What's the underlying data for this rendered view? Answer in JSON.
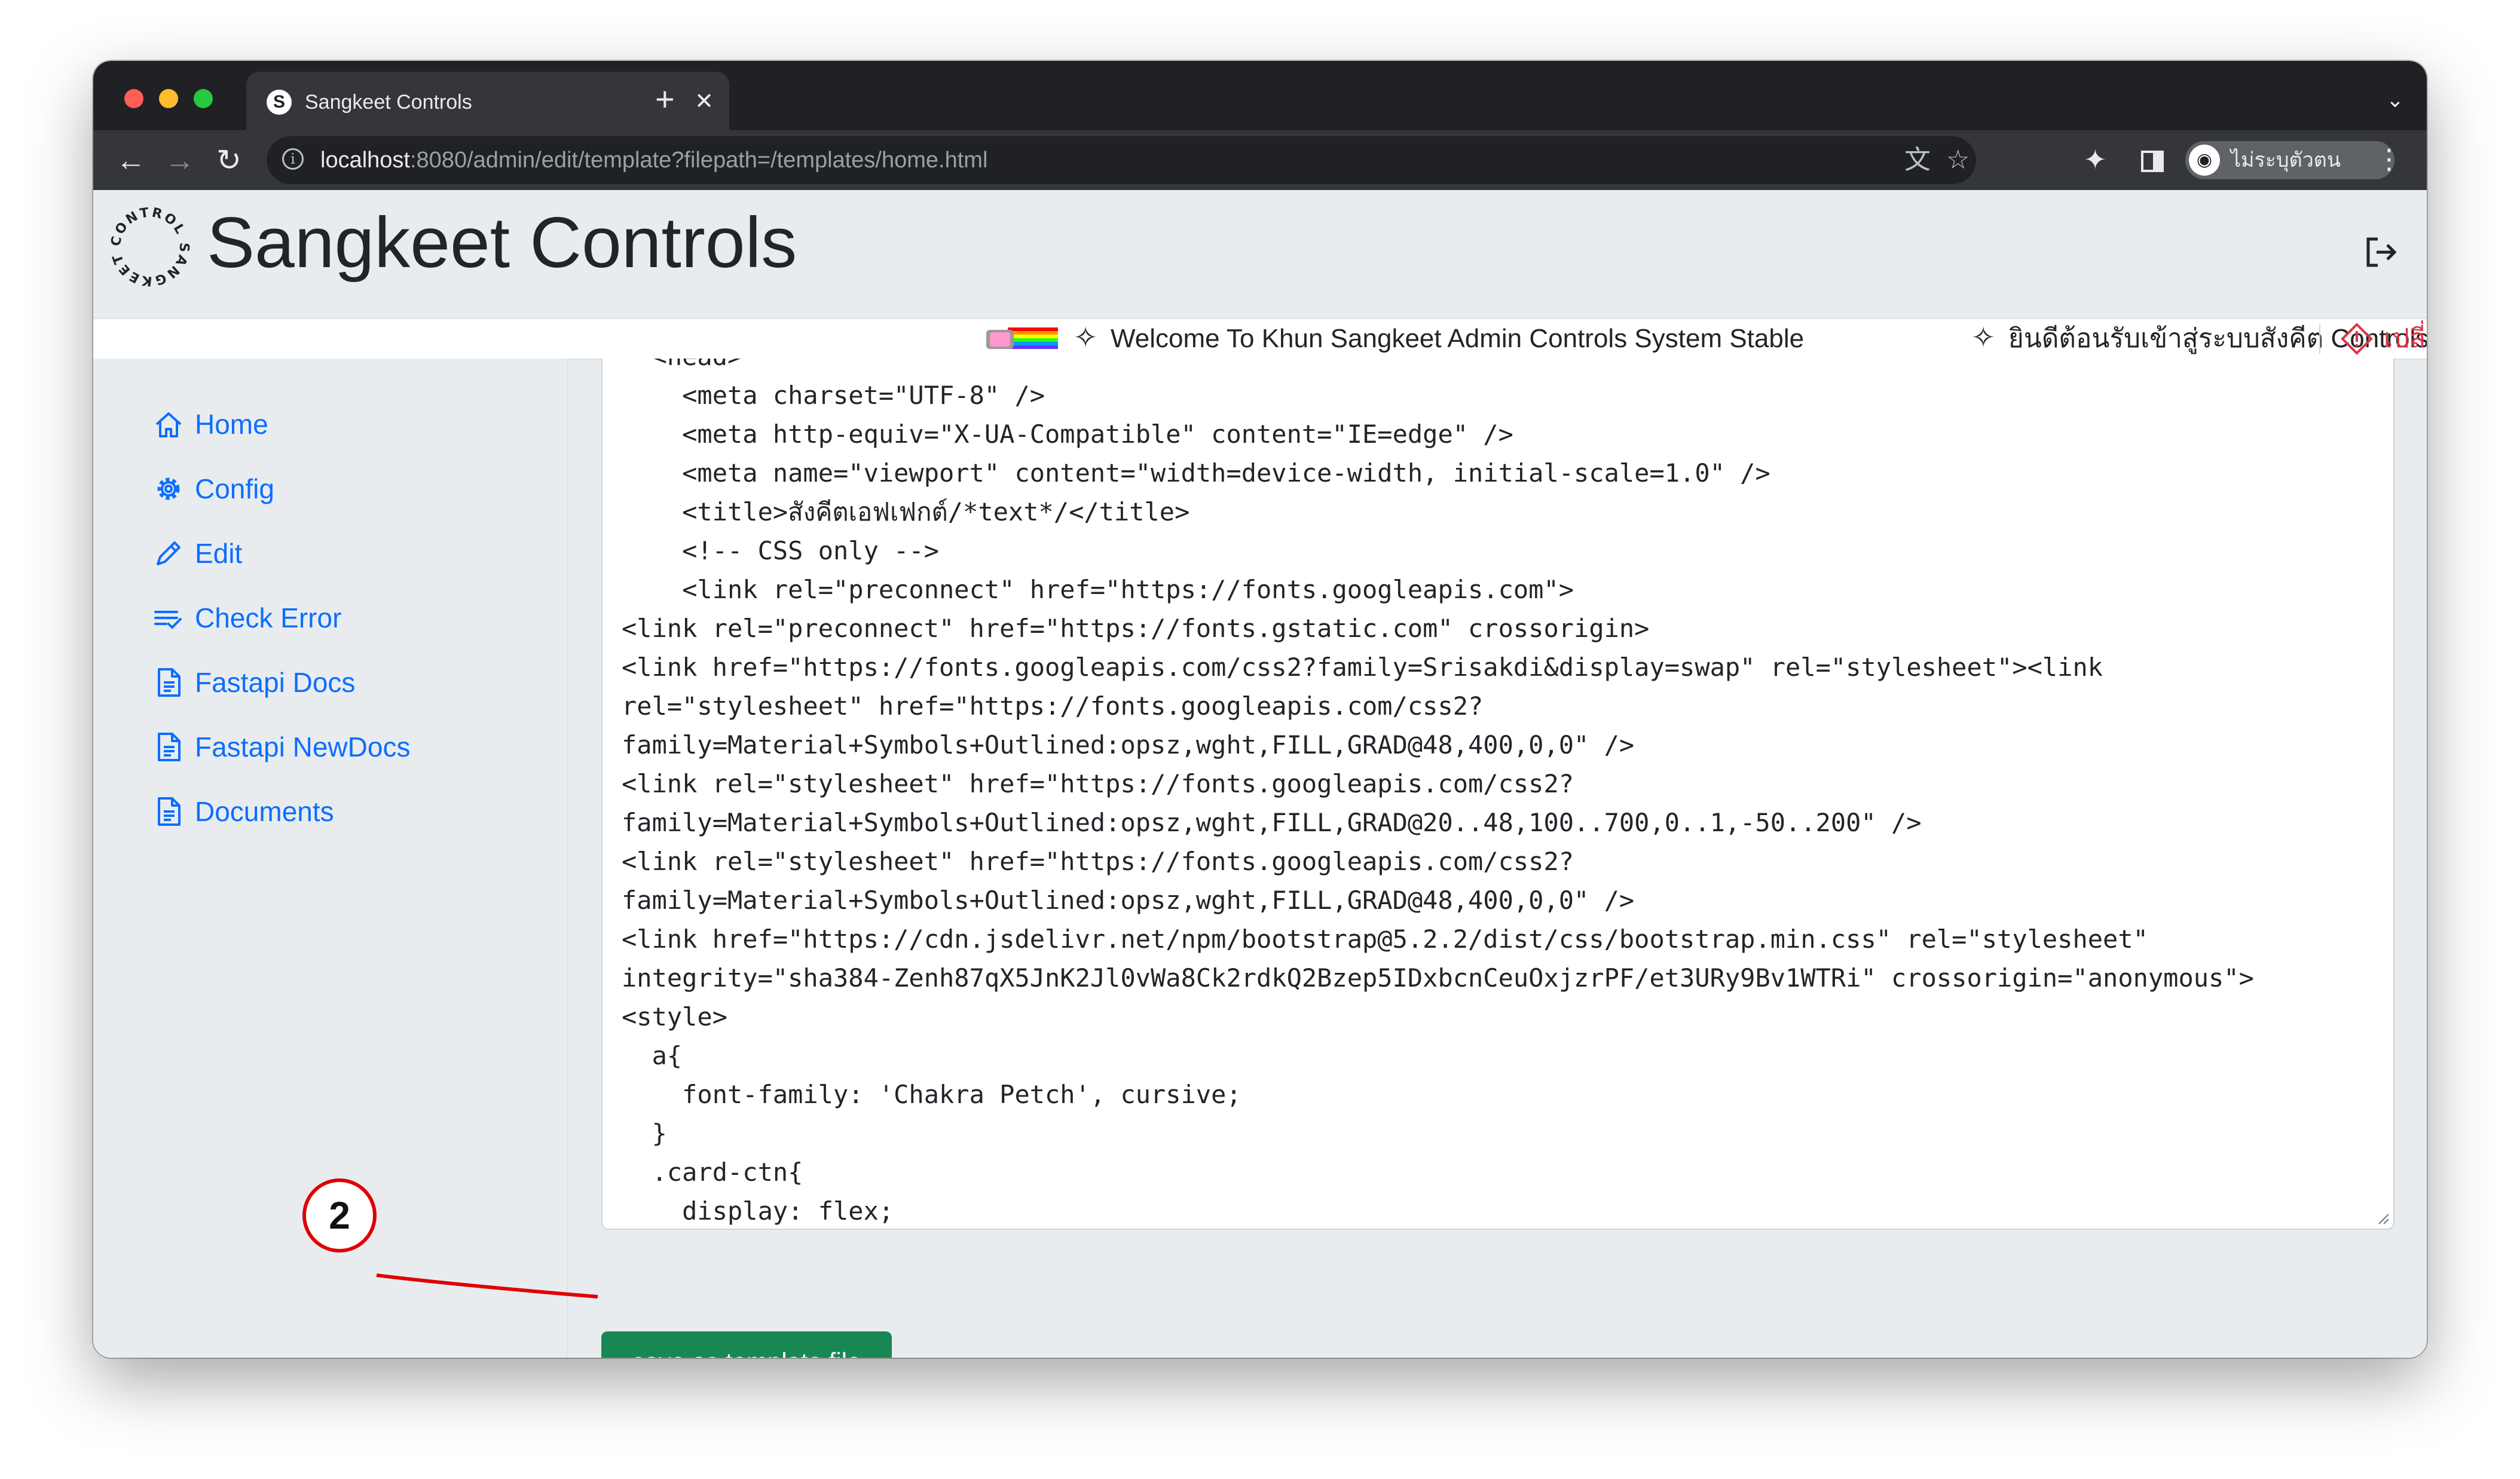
{
  "browser": {
    "tab_title": "Sangkeet Controls",
    "tab_close": "✕",
    "new_tab": "+",
    "url_host": "localhost",
    "url_rest": ":8080/admin/edit/template?filepath=/templates/home.html",
    "profile_label": "ไม่ระบุตัวตน"
  },
  "site": {
    "title": "Sangkeet Controls",
    "logo_text": "CONTROL SANGKEET"
  },
  "marquee": {
    "welcome_en": "Welcome To Khun Sangkeet Admin Controls System Stable",
    "welcome_th": "ยินดีต้อนรับเข้าสู่ระบบสังคีต Controls",
    "alert_prefix": "เปลี่"
  },
  "sidebar": {
    "items": [
      {
        "label": "Home",
        "icon": "house-icon"
      },
      {
        "label": "Config",
        "icon": "gear-icon"
      },
      {
        "label": "Edit",
        "icon": "pencil-icon"
      },
      {
        "label": "Check Error",
        "icon": "list-check-icon"
      },
      {
        "label": "Fastapi Docs",
        "icon": "document-icon"
      },
      {
        "label": "Fastapi NewDocs",
        "icon": "document-icon"
      },
      {
        "label": "Documents",
        "icon": "document-icon"
      }
    ]
  },
  "editor": {
    "content": "  <head>\n    <meta charset=\"UTF-8\" />\n    <meta http-equiv=\"X-UA-Compatible\" content=\"IE=edge\" />\n    <meta name=\"viewport\" content=\"width=device-width, initial-scale=1.0\" />\n    <title>สังคีตเอฟเฟกต์/*text*/</title>\n    <!-- CSS only -->\n    <link rel=\"preconnect\" href=\"https://fonts.googleapis.com\">\n<link rel=\"preconnect\" href=\"https://fonts.gstatic.com\" crossorigin>\n<link href=\"https://fonts.googleapis.com/css2?family=Srisakdi&display=swap\" rel=\"stylesheet\"><link\nrel=\"stylesheet\" href=\"https://fonts.googleapis.com/css2?\nfamily=Material+Symbols+Outlined:opsz,wght,FILL,GRAD@48,400,0,0\" />\n<link rel=\"stylesheet\" href=\"https://fonts.googleapis.com/css2?\nfamily=Material+Symbols+Outlined:opsz,wght,FILL,GRAD@20..48,100..700,0..1,-50..200\" />\n<link rel=\"stylesheet\" href=\"https://fonts.googleapis.com/css2?\nfamily=Material+Symbols+Outlined:opsz,wght,FILL,GRAD@48,400,0,0\" />\n<link href=\"https://cdn.jsdelivr.net/npm/bootstrap@5.2.2/dist/css/bootstrap.min.css\" rel=\"stylesheet\"\nintegrity=\"sha384-Zenh87qX5JnK2Jl0vWa8Ck2rdkQ2Bzep5IDxbcnCeuOxjzrPF/et3URy9Bv1WTRi\" crossorigin=\"anonymous\">\n<style>\n  a{\n    font-family: 'Chakra Petch', cursive;\n  }\n  .card-ctn{\n    display: flex;"
  },
  "actions": {
    "save_label": "save as template file"
  },
  "annotation": {
    "callout_number": "2",
    "color": "#e00000"
  },
  "colors": {
    "link": "#0d6efd",
    "save_button": "#198754",
    "alert": "#dc3545"
  }
}
